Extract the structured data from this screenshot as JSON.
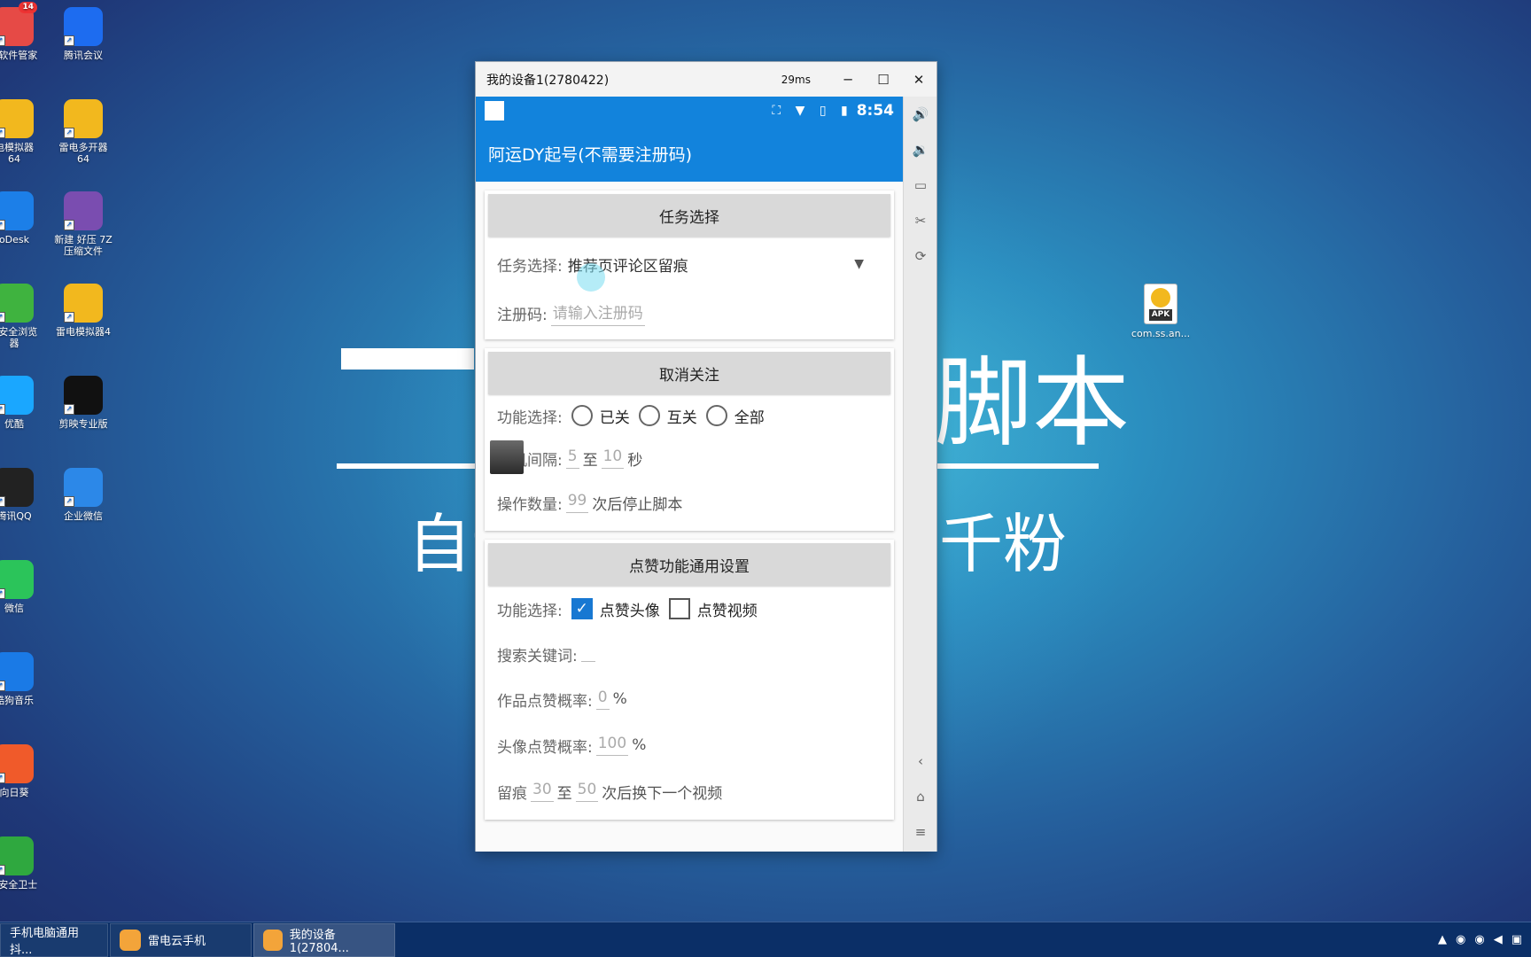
{
  "desktop": {
    "icons_col1": [
      {
        "label": "D软件管家",
        "badge": "14",
        "color": "#e64a46"
      },
      {
        "label": "电模拟器\n64",
        "color": "#f2b81e"
      },
      {
        "label": "oDesk",
        "color": "#1c7fe8"
      },
      {
        "label": "D安全浏览\n器",
        "color": "#3fb33f"
      },
      {
        "label": "优酷",
        "color": "#1aa7ff"
      },
      {
        "label": "腾讯QQ",
        "color": "#222222"
      },
      {
        "label": "微信",
        "color": "#2bc45a"
      },
      {
        "label": "酷狗音乐",
        "color": "#1a7ae6"
      },
      {
        "label": "向日葵",
        "color": "#f05a2a"
      },
      {
        "label": "D安全卫士",
        "color": "#2fa83f"
      }
    ],
    "icons_col2": [
      {
        "label": "腾讯会议",
        "color": "#1d6cf0"
      },
      {
        "label": "雷电多开器\n64",
        "color": "#f2b81e"
      },
      {
        "label": "新建 好压 7Z\n压缩文件",
        "color": "#7a4db0"
      },
      {
        "label": "雷电模拟器4",
        "color": "#f2b81e"
      },
      {
        "label": "剪映专业版",
        "color": "#111111"
      },
      {
        "label": "企业微信",
        "color": "#2c88e8"
      }
    ],
    "apk_icon": {
      "label": "com.ss.an...",
      "tag": "APK"
    },
    "bg_text_1": "脚本",
    "bg_text_2": "自动",
    "bg_text_3": "千粉"
  },
  "window": {
    "title": "我的设备1(2780422)",
    "ping": "29ms",
    "minimize": "─",
    "maximize": "☐",
    "close": "✕"
  },
  "phone": {
    "status_icons": "⛶ ▼ ▯ ▮",
    "time": "8:54",
    "app_title": "阿运DY起号(不需要注册码)",
    "task_section": {
      "header": "任务选择",
      "task_label": "任务选择:",
      "task_value": "推荐页评论区留痕",
      "reg_label": "注册码:",
      "reg_placeholder": "请输入注册码"
    },
    "unfollow_section": {
      "header": "取消关注",
      "func_label": "功能选择:",
      "options": [
        "已关",
        "互关",
        "全部"
      ],
      "interval_label": "随机间隔:",
      "interval_min": "5",
      "interval_to": "至",
      "interval_max": "10",
      "interval_unit": "秒",
      "count_label": "操作数量:",
      "count_value": "99",
      "count_suffix": "次后停止脚本"
    },
    "like_section": {
      "header": "点赞功能通用设置",
      "func_label": "功能选择:",
      "like_avatar": "点赞头像",
      "like_video": "点赞视频",
      "like_avatar_checked": true,
      "like_video_checked": false,
      "keyword_label": "搜索关键词:",
      "keyword_value": "",
      "work_rate_label": "作品点赞概率:",
      "work_rate_value": "0",
      "avatar_rate_label": "头像点赞概率:",
      "avatar_rate_value": "100",
      "percent": "%",
      "trace_label": "留痕",
      "trace_min": "30",
      "trace_to": "至",
      "trace_max": "50",
      "trace_suffix": "次后换下一个视频"
    }
  },
  "side_toolbar": [
    "volume-up-icon",
    "volume-down-icon",
    "folder-icon",
    "scissors-icon",
    "rotate-icon",
    "back-icon",
    "home-icon",
    "menu-icon"
  ],
  "taskbar": {
    "items": [
      "手机电脑通用抖...",
      "雷电云手机",
      "我的设备1(27804..."
    ]
  }
}
